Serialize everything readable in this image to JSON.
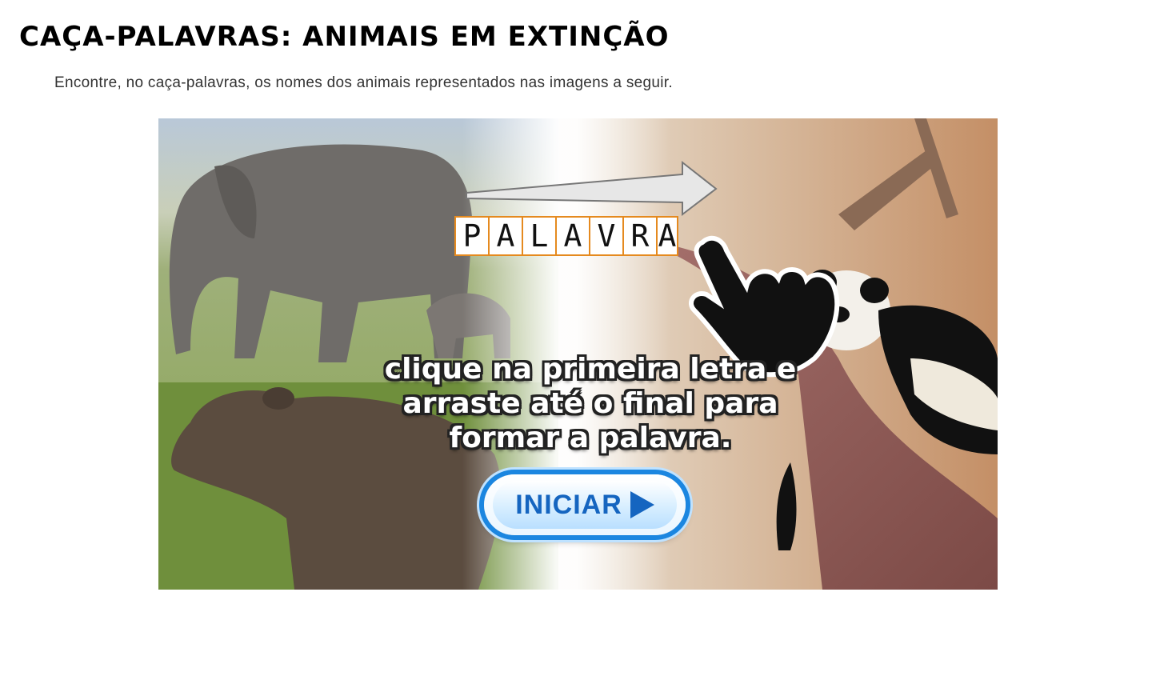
{
  "page": {
    "title": "CAÇA-PALAVRAS: ANIMAIS EM EXTINÇÃO",
    "instructions": "Encontre, no caça-palavras, os nomes dos animais representados nas imagens a seguir."
  },
  "game": {
    "word_example_letters": [
      "P",
      "A",
      "L",
      "A",
      "V",
      "R",
      "A"
    ],
    "hint_lines": [
      "clique na primeira letra e",
      "arraste até o final para",
      "formar a palavra."
    ],
    "start_label": "INICIAR",
    "images": [
      "elephant",
      "tapir",
      "panda"
    ],
    "icons": [
      "arrow-right-icon",
      "pointing-hand-icon",
      "play-icon"
    ],
    "colors": {
      "button_border": "#1b86e0",
      "button_text": "#1565c0",
      "letter_border": "#e58a1f"
    }
  }
}
